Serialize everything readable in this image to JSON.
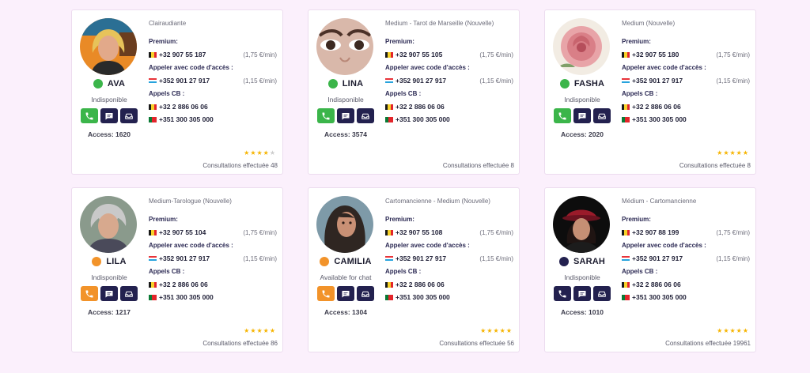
{
  "colors": {
    "page_bg": "#fbf0fc",
    "navy": "#23214f",
    "green": "#3bb54a",
    "orange": "#f2932a",
    "dark_dot": "#23214f",
    "star": "#f6b400"
  },
  "labels": {
    "premium": "Premium:",
    "code_access": "Appeler avec code d'accès :",
    "cb": "Appels CB :"
  },
  "cards": [
    {
      "name": "AVA",
      "specialty": "Clairaudiante",
      "status": "Indisponible",
      "status_color": "#3bb54a",
      "access": "Access: 1620",
      "premium_number": "+32 907 55 187",
      "premium_rate": "(1,75 €/min)",
      "code_number": "+352 901 27 917",
      "code_rate": "(1,15 €/min)",
      "cb_be": "+32 2 886 06 06",
      "cb_pt": "+351 300 305 000",
      "rating": 4,
      "consultations": "Consultations effectuée 48",
      "avatar": "blonde-woman-portrait"
    },
    {
      "name": "LINA",
      "specialty": "Medium - Tarot de Marseille (Nouvelle)",
      "status": "Indisponible",
      "status_color": "#3bb54a",
      "access": "Access: 3574",
      "premium_number": "+32 907 55 105",
      "premium_rate": "(1,75 €/min)",
      "code_number": "+352 901 27 917",
      "code_rate": "(1,15 €/min)",
      "cb_be": "+32 2 886 06 06",
      "cb_pt": "+351 300 305 000",
      "rating": 0,
      "consultations": "Consultations effectuée 8",
      "avatar": "eyes-closeup"
    },
    {
      "name": "FASHA",
      "specialty": "Medium (Nouvelle)",
      "status": "Indisponible",
      "status_color": "#3bb54a",
      "access": "Access: 2020",
      "premium_number": "+32 907 55 180",
      "premium_rate": "(1,75 €/min)",
      "code_number": "+352 901 27 917",
      "code_rate": "(1,15 €/min)",
      "cb_be": "+32 2 886 06 06",
      "cb_pt": "+351 300 305 000",
      "rating": 5,
      "consultations": "Consultations effectuée 8",
      "avatar": "rose-flower"
    },
    {
      "name": "LILA",
      "specialty": "Medium-Tarologue (Nouvelle)",
      "status": "Indisponible",
      "status_color": "#f2932a",
      "access": "Access: 1217",
      "premium_number": "+32 907 55 104",
      "premium_rate": "(1,75 €/min)",
      "code_number": "+352 901 27 917",
      "code_rate": "(1,15 €/min)",
      "cb_be": "+32 2 886 06 06",
      "cb_pt": "+351 300 305 000",
      "rating": 5,
      "consultations": "Consultations effectuée 86",
      "avatar": "grey-haired-woman-portrait"
    },
    {
      "name": "CAMILIA",
      "specialty": "Cartomancienne - Medium (Nouvelle)",
      "status": "Available for chat",
      "status_color": "#f2932a",
      "access": "Access: 1304",
      "premium_number": "+32 907 55 108",
      "premium_rate": "(1,75 €/min)",
      "code_number": "+352 901 27 917",
      "code_rate": "(1,15 €/min)",
      "cb_be": "+32 2 886 06 06",
      "cb_pt": "+351 300 305 000",
      "rating": 5,
      "consultations": "Consultations effectuée 56",
      "avatar": "dark-haired-woman-portrait"
    },
    {
      "name": "SARAH",
      "specialty": "Médium - Cartomancienne",
      "status": "Indisponible",
      "status_color": "#23214f",
      "access": "Access: 1010",
      "premium_number": "+32 907 88 199",
      "premium_rate": "(1,75 €/min)",
      "code_number": "+352 901 27 917",
      "code_rate": "(1,15 €/min)",
      "cb_be": "+32 2 886 06 06",
      "cb_pt": "+351 300 305 000",
      "rating": 5,
      "consultations": "Consultations effectuée 19961",
      "avatar": "woman-red-hat-portrait"
    }
  ]
}
